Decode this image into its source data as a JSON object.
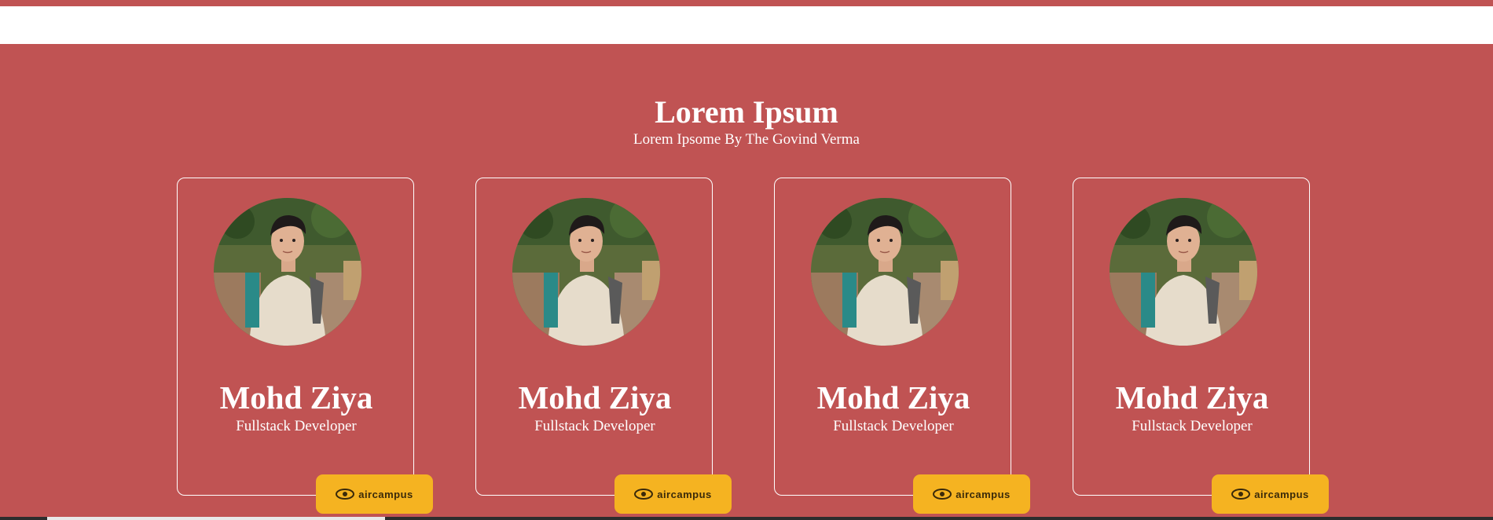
{
  "header": {
    "title": "Lorem Ipsum",
    "subtitle": "Lorem Ipsome By The Govind Verma"
  },
  "cards": [
    {
      "name": "Mohd Ziya",
      "role": "Fullstack Developer",
      "badge_label": "aircampus"
    },
    {
      "name": "Mohd Ziya",
      "role": "Fullstack Developer",
      "badge_label": "aircampus"
    },
    {
      "name": "Mohd Ziya",
      "role": "Fullstack Developer",
      "badge_label": "aircampus"
    },
    {
      "name": "Mohd Ziya",
      "role": "Fullstack Developer",
      "badge_label": "aircampus"
    }
  ],
  "colors": {
    "background": "#c05353",
    "badge": "#f5b321",
    "text": "#ffffff"
  }
}
